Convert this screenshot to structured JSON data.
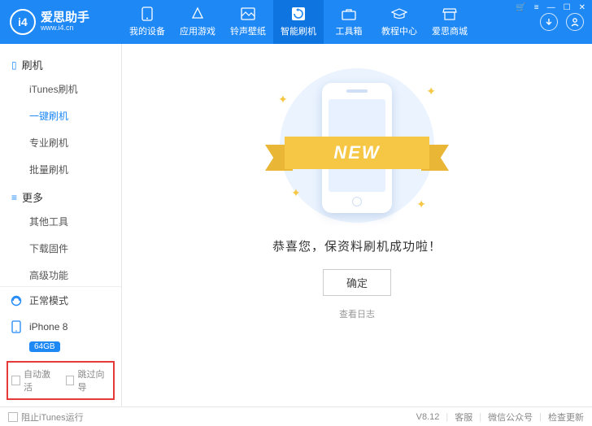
{
  "logo": {
    "badge": "i4",
    "title": "爱思助手",
    "subtitle": "www.i4.cn"
  },
  "nav": [
    {
      "label": "我的设备"
    },
    {
      "label": "应用游戏"
    },
    {
      "label": "铃声壁纸"
    },
    {
      "label": "智能刷机"
    },
    {
      "label": "工具箱"
    },
    {
      "label": "教程中心"
    },
    {
      "label": "爱思商城"
    }
  ],
  "sidebar": {
    "group1": {
      "title": "刷机",
      "items": [
        "iTunes刷机",
        "一键刷机",
        "专业刷机",
        "批量刷机"
      ]
    },
    "group2": {
      "title": "更多",
      "items": [
        "其他工具",
        "下载固件",
        "高级功能"
      ]
    },
    "mode": "正常模式",
    "device": "iPhone 8",
    "storage": "64GB",
    "checks": [
      "自动激活",
      "跳过向导"
    ]
  },
  "main": {
    "ribbon": "NEW",
    "message": "恭喜您，保资料刷机成功啦！",
    "ok": "确定",
    "log": "查看日志"
  },
  "footer": {
    "block_itunes": "阻止iTunes运行",
    "version": "V8.12",
    "support": "客服",
    "wechat": "微信公众号",
    "update": "检查更新"
  }
}
